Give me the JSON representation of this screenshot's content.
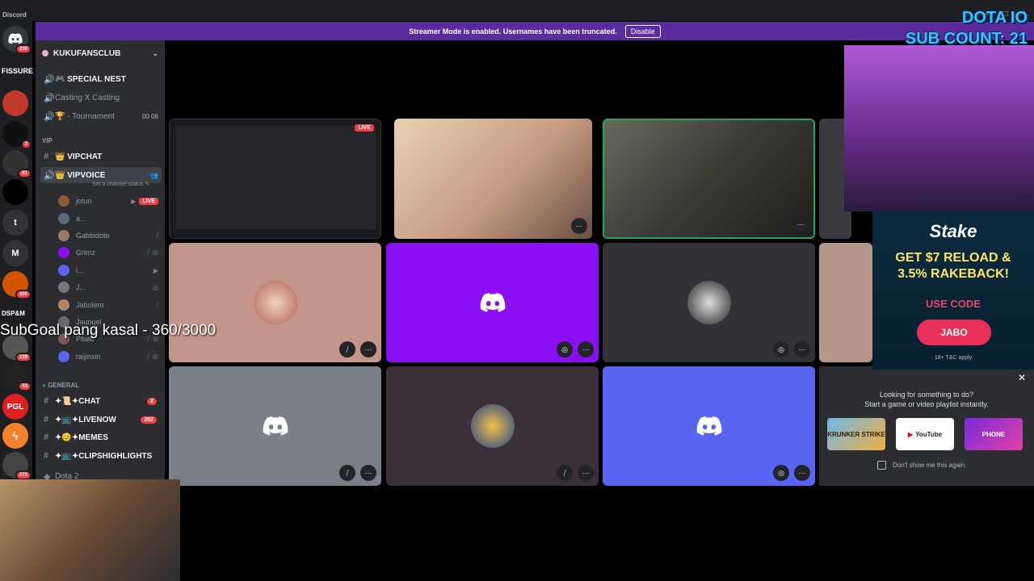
{
  "titlebar": {
    "app_name": "Discord"
  },
  "banner": {
    "text": "Streamer Mode is enabled. Usernames have been truncated.",
    "button": "Disable"
  },
  "rail": {
    "home_badge": "230",
    "fissure": "FISSURE",
    "badges": [
      "3",
      "61",
      "205",
      "228",
      "53",
      "272"
    ],
    "letters": [
      "t",
      "M"
    ],
    "dsp": "DSP&M",
    "pgl": "PGL"
  },
  "sidebar": {
    "server": "KUKUFANSCLUB",
    "channels_top": [
      {
        "label": "🎮 SPECIAL NEST"
      },
      {
        "label": "Casting X Casting"
      },
      {
        "label": "🏆 - Tournament",
        "right": "00  06"
      }
    ],
    "cat_vip": "VIP",
    "vipchat": "👑 VIPCHAT",
    "vipvoice": "👑 VIPVOICE",
    "status_sub": "Set a channel status ✎",
    "voice_users": [
      {
        "name": "jotun",
        "live": "LIVE"
      },
      {
        "name": "a..."
      },
      {
        "name": "Gabbidoto"
      },
      {
        "name": "Grimz"
      },
      {
        "name": "i..."
      },
      {
        "name": "J..."
      },
      {
        "name": "Jabolero"
      },
      {
        "name": "Jaunuel"
      },
      {
        "name": "Pilato"
      },
      {
        "name": "raijinxin"
      }
    ],
    "cat_general": "GENERAL",
    "general": [
      {
        "label": "✦📜✦CHAT",
        "count": "2"
      },
      {
        "label": "✦📺✦LIVENOW",
        "count": "202"
      },
      {
        "label": "✦😊✦MEMES"
      },
      {
        "label": "✦📺✦CLIPSHIGHLIGHTS"
      }
    ],
    "dota": "Dota 2"
  },
  "tiles": {
    "live": "LIVE"
  },
  "overlay": {
    "dota_line1": "DOTA IO",
    "dota_line2": "SUB COUNT: 21",
    "subgoal": "SubGoal pang kasal - 360/3000"
  },
  "stake": {
    "logo": "Stake",
    "promo1": "GET $7 RELOAD &",
    "promo2": "3.5% RAKEBACK!",
    "use_code": "USE CODE",
    "code": "JABO",
    "tc": "18+ T&C apply"
  },
  "activity": {
    "line1": "Looking for something to do?",
    "line2": "Start a game or video playlist instantly.",
    "cards": [
      "KRUNKER STRIKE",
      "YouTube",
      "PHONE"
    ],
    "dont_show": "Don't show me this again."
  },
  "colors": {
    "discord_blurple": "#5865f2",
    "purple_tile": "#8a0ff5",
    "banner": "#5c2c9e"
  }
}
